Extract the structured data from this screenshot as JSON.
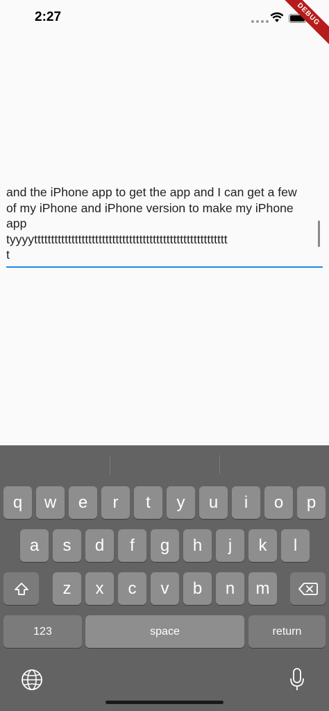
{
  "status_bar": {
    "time": "2:27",
    "debug_label": "DEBUG"
  },
  "text_field": {
    "lines": [
      "and the iPhone app to get the app and I can get a few",
      "of my iPhone and iPhone version to make my iPhone",
      "app",
      "tyyyyttttttttttttttttttttttttttttttttttttttttttttttttttttttttt",
      "t"
    ]
  },
  "keyboard": {
    "row1": [
      "q",
      "w",
      "e",
      "r",
      "t",
      "y",
      "u",
      "i",
      "o",
      "p"
    ],
    "row2": [
      "a",
      "s",
      "d",
      "f",
      "g",
      "h",
      "j",
      "k",
      "l"
    ],
    "row3": [
      "z",
      "x",
      "c",
      "v",
      "b",
      "n",
      "m"
    ],
    "numbers_label": "123",
    "space_label": "space",
    "return_label": "return",
    "icons": {
      "shift": "shift-icon",
      "delete": "delete-icon",
      "globe": "globe-icon",
      "mic": "mic-icon"
    }
  },
  "colors": {
    "accent": "#1e88e5",
    "debug": "#b71c1c",
    "keyboard_bg": "#636363",
    "key": "#8e8e8e"
  }
}
